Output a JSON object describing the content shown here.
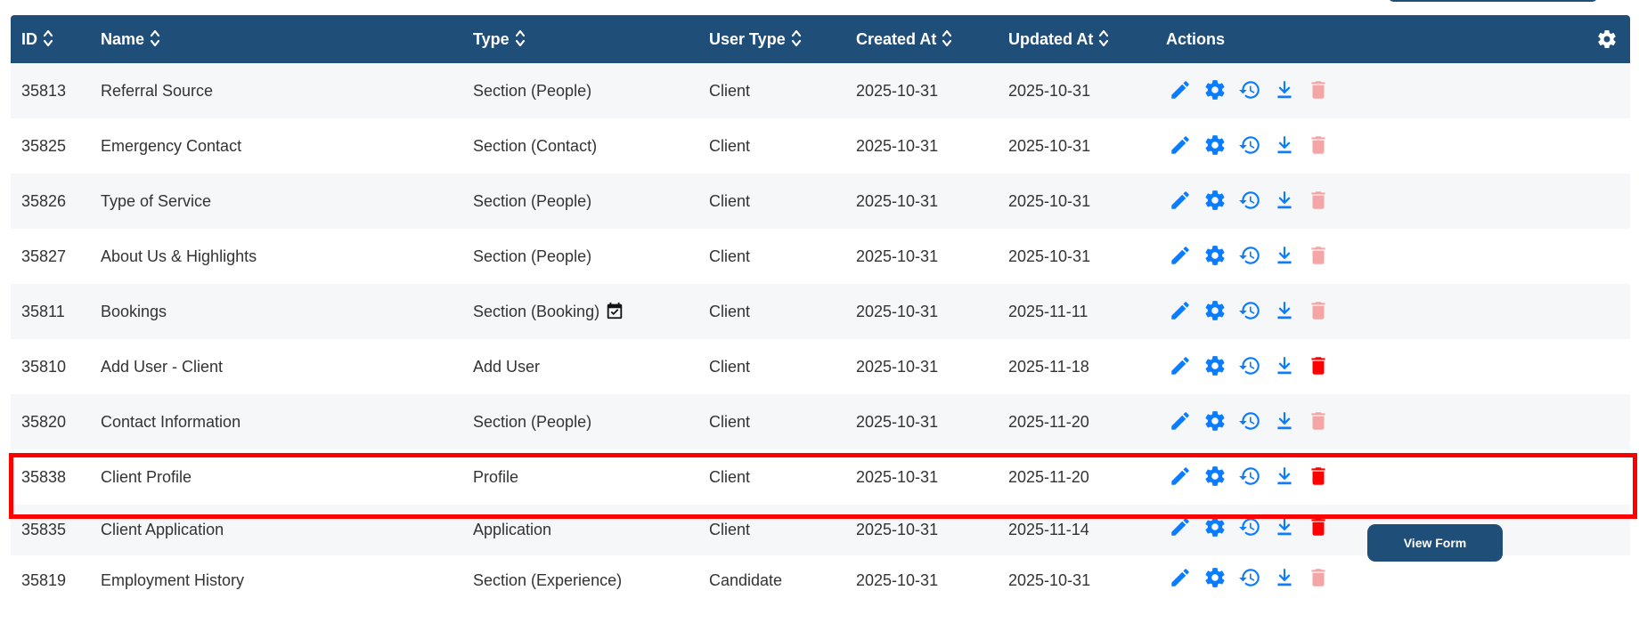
{
  "colors": {
    "header_bg": "#1f4e79",
    "icon_blue": "#0a7cff",
    "delete_red": "#ff0000",
    "delete_disabled": "#f4a6a6",
    "highlight": "#ff0000"
  },
  "table": {
    "columns": [
      {
        "label": "ID",
        "sortable": true
      },
      {
        "label": "Name",
        "sortable": true
      },
      {
        "label": "Type",
        "sortable": true
      },
      {
        "label": "User Type",
        "sortable": true
      },
      {
        "label": "Created At",
        "sortable": true
      },
      {
        "label": "Updated At",
        "sortable": true
      },
      {
        "label": "Actions",
        "sortable": false
      }
    ],
    "rows": [
      {
        "id": "35813",
        "name": "Referral Source",
        "type": "Section (People)",
        "user_type": "Client",
        "created": "2025-10-31",
        "updated": "2025-10-31",
        "delete_enabled": false
      },
      {
        "id": "35825",
        "name": "Emergency Contact",
        "type": "Section (Contact)",
        "user_type": "Client",
        "created": "2025-10-31",
        "updated": "2025-10-31",
        "delete_enabled": false
      },
      {
        "id": "35826",
        "name": "Type of Service",
        "type": "Section (People)",
        "user_type": "Client",
        "created": "2025-10-31",
        "updated": "2025-10-31",
        "delete_enabled": false
      },
      {
        "id": "35827",
        "name": "About Us & Highlights",
        "type": "Section (People)",
        "user_type": "Client",
        "created": "2025-10-31",
        "updated": "2025-10-31",
        "delete_enabled": false
      },
      {
        "id": "35811",
        "name": "Bookings",
        "type": "Section (Booking)",
        "type_icon": "calendar-check-icon",
        "user_type": "Client",
        "created": "2025-10-31",
        "updated": "2025-11-11",
        "delete_enabled": false
      },
      {
        "id": "35810",
        "name": "Add User - Client",
        "type": "Add User",
        "user_type": "Client",
        "created": "2025-10-31",
        "updated": "2025-11-18",
        "delete_enabled": true
      },
      {
        "id": "35820",
        "name": "Contact Information",
        "type": "Section (People)",
        "user_type": "Client",
        "created": "2025-10-31",
        "updated": "2025-11-20",
        "delete_enabled": false
      },
      {
        "id": "35838",
        "name": "Client Profile",
        "type": "Profile",
        "user_type": "Client",
        "created": "2025-10-31",
        "updated": "2025-11-20",
        "delete_enabled": true,
        "highlighted": true
      },
      {
        "id": "35835",
        "name": "Client Application",
        "type": "Application",
        "user_type": "Client",
        "created": "2025-10-31",
        "updated": "2025-11-14",
        "delete_enabled": true,
        "view_form": "View Form"
      },
      {
        "id": "35819",
        "name": "Employment History",
        "type": "Section (Experience)",
        "user_type": "Candidate",
        "created": "2025-10-31",
        "updated": "2025-10-31",
        "delete_enabled": false
      }
    ],
    "action_icons": [
      "pencil-icon",
      "gear-icon",
      "history-icon",
      "download-icon",
      "trash-icon"
    ]
  }
}
